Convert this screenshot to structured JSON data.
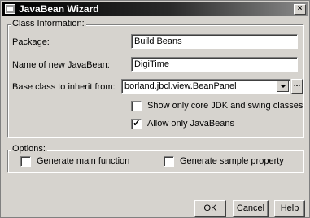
{
  "window": {
    "title": "JavaBean Wizard",
    "close_glyph": "×"
  },
  "class_info": {
    "legend": "Class Information:",
    "package_label": "Package:",
    "package_value_before_caret": "Build",
    "package_value_after_caret": "Beans",
    "name_label": "Name of new JavaBean:",
    "name_value": "DigiTime",
    "base_class_label": "Base class to inherit from:",
    "base_class_value": "borland.jbcl.view.BeanPanel",
    "browse_glyph": "...",
    "show_core_only_label": "Show only core JDK and swing classes",
    "show_core_only_checked": false,
    "allow_only_javabeans_label": "Allow only JavaBeans",
    "allow_only_javabeans_checked": true,
    "check_glyph": "✓"
  },
  "options": {
    "legend": "Options:",
    "generate_main_label": "Generate main function",
    "generate_main_checked": false,
    "generate_sample_label": "Generate sample property",
    "generate_sample_checked": false
  },
  "buttons": {
    "ok": "OK",
    "cancel": "Cancel",
    "help": "Help"
  }
}
